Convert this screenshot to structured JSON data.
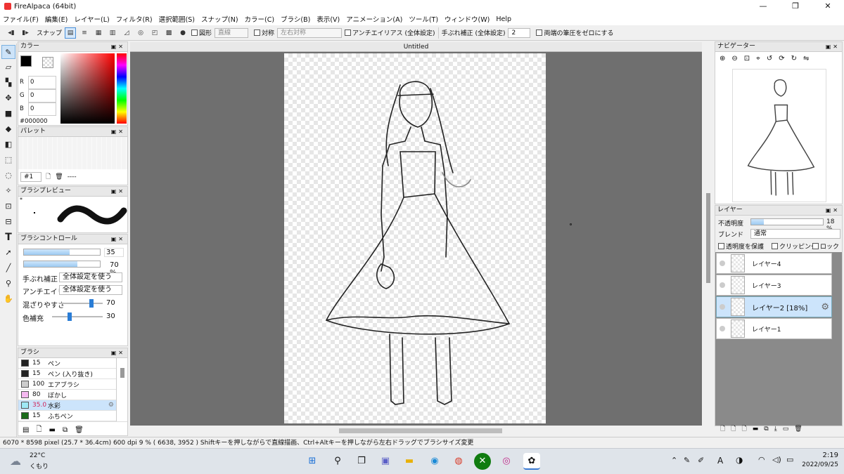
{
  "app": {
    "title": "FireAlpaca (64bit)"
  },
  "window_controls": {
    "minimize": "—",
    "restore": "❐",
    "close": "✕"
  },
  "menu": [
    "ファイル(F)",
    "編集(E)",
    "レイヤー(L)",
    "フィルタ(R)",
    "選択範囲(S)",
    "スナップ(N)",
    "カラー(C)",
    "ブラシ(B)",
    "表示(V)",
    "アニメーション(A)",
    "ツール(T)",
    "ウィンドウ(W)",
    "Help"
  ],
  "toolbar": {
    "snap_label": "スナップ",
    "shape_label": "図形",
    "shape_value": "直線",
    "sym_label": "対称",
    "sym_value": "左右対称",
    "aa_label": "アンチエイリアス (全体設定)",
    "stab_label": "手ぶれ補正 (全体設定)",
    "stab_value": "2",
    "pressure_label": "両端の筆圧をゼロにする"
  },
  "color_panel": {
    "title": "カラー",
    "r_label": "R",
    "r": "0",
    "g_label": "G",
    "g": "0",
    "b_label": "B",
    "b": "0",
    "hex": "#000000",
    "primary": "#000000"
  },
  "palette_panel": {
    "title": "パレット",
    "num": "#1",
    "dashes": "----"
  },
  "brush_preview": {
    "title": "ブラシプレビュー",
    "star": "*"
  },
  "brush_control": {
    "title": "ブラシコントロール",
    "size": "35",
    "opacity": "70 %",
    "opacity_value": 0.7,
    "size_fraction": 0.6,
    "stab_label": "手ぶれ補正",
    "stab_value": "全体設定を使う",
    "aa_label": "アンチエイリアス",
    "aa_value": "全体設定を使う",
    "blend_label": "混ざりやすさ",
    "blend": "70",
    "blend_value": 0.7,
    "fill_label": "色補充",
    "fill": "30",
    "fill_value": 0.3
  },
  "brush_panel": {
    "title": "ブラシ",
    "items": [
      {
        "size": "15",
        "name": "ペン",
        "color": "#222222"
      },
      {
        "size": "15",
        "name": "ペン (入り抜き)",
        "color": "#222222"
      },
      {
        "size": "100",
        "name": "エアブラシ",
        "color": "#cccccc"
      },
      {
        "size": "80",
        "name": "ぼかし",
        "color": "#f5b8f0"
      },
      {
        "size": "35.0",
        "name": "水彩",
        "color": "#9ee8f5",
        "selected": true
      },
      {
        "size": "15",
        "name": "ふちペン",
        "color": "#1a6b1a"
      }
    ]
  },
  "document": {
    "tab": "Untitled"
  },
  "navigator": {
    "title": "ナビゲーター"
  },
  "layer_panel": {
    "title": "レイヤー",
    "opacity_label": "不透明度",
    "opacity": "18 %",
    "opacity_value": 0.18,
    "blend_label": "ブレンド",
    "blend_value": "通常",
    "protect_label": "透明度を保護",
    "clip_label": "クリッピング",
    "lock_label": "ロック",
    "layers": [
      {
        "name": "レイヤー4"
      },
      {
        "name": "レイヤー3"
      },
      {
        "name": "レイヤー2 [18%]",
        "selected": true
      },
      {
        "name": "レイヤー1"
      }
    ]
  },
  "status": {
    "text": "6070 * 8598 pixel (25.7 * 36.4cm) 600 dpi 9 % ( 6638, 3952 ) Shiftキーを押しながらで直線描画、Ctrl+Altキーを押しながら左右ドラッグでブラシサイズ変更"
  },
  "taskbar": {
    "temp": "22°C",
    "weather": "くもり",
    "ime": "A",
    "time": "2:19",
    "date": "2022/09/25"
  }
}
